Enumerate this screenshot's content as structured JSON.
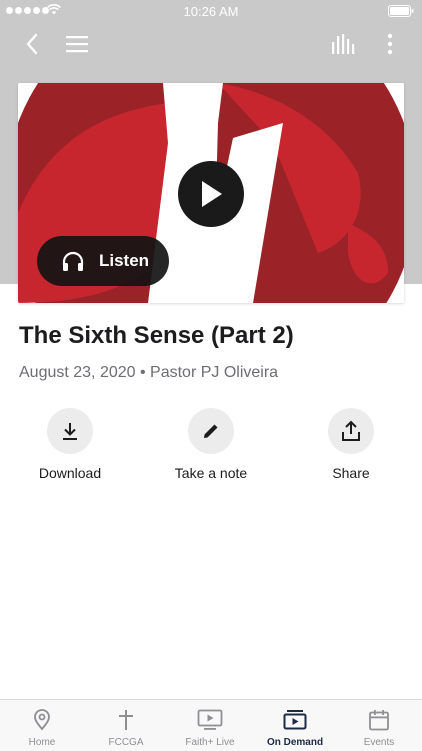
{
  "status_bar": {
    "time": "10:26 AM"
  },
  "sermon": {
    "title": "The Sixth Sense (Part 2)",
    "meta": "August 23, 2020 • Pastor PJ Oliveira",
    "listen_label": "Listen"
  },
  "actions": [
    {
      "label": "Download",
      "icon": "download-icon"
    },
    {
      "label": "Take a note",
      "icon": "pencil-icon"
    },
    {
      "label": "Share",
      "icon": "share-icon"
    }
  ],
  "tabs": [
    {
      "label": "Home",
      "icon": "location-pin-icon",
      "active": false
    },
    {
      "label": "FCCGA",
      "icon": "cross-icon",
      "active": false
    },
    {
      "label": "Faith+ Live",
      "icon": "tv-play-icon",
      "active": false
    },
    {
      "label": "On Demand",
      "icon": "video-library-icon",
      "active": true
    },
    {
      "label": "Events",
      "icon": "calendar-icon",
      "active": false
    }
  ],
  "colors": {
    "header_bg": "#c9c9c9",
    "art_red_dark": "#9b2328",
    "art_red": "#c8262e",
    "active_tab": "#1d2a44",
    "inactive_tab": "#8e8e93"
  }
}
